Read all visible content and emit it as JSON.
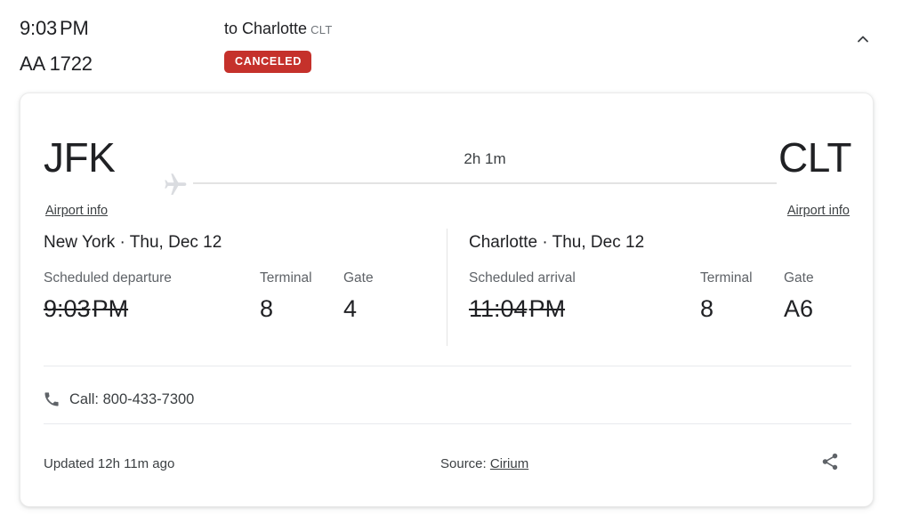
{
  "header": {
    "departure_time": "9:03",
    "departure_ampm": "PM",
    "flight_number": "AA 1722",
    "destination_prefix": "to Charlotte",
    "destination_code": "CLT",
    "status_badge": "CANCELED",
    "collapse_icon": "chevron-up-icon",
    "badge_color": "#c5312b"
  },
  "route": {
    "origin_code": "JFK",
    "destination_code": "CLT",
    "origin_airport_info": "Airport info",
    "destination_airport_info": "Airport info",
    "duration": "2h 1m",
    "plane_icon": "airplane-icon"
  },
  "departure": {
    "title": "New York · Thu, Dec 12",
    "time_label": "Scheduled departure",
    "time_value": "9:03",
    "time_ampm": "PM",
    "time_struck": true,
    "terminal_label": "Terminal",
    "terminal_value": "8",
    "gate_label": "Gate",
    "gate_value": "4"
  },
  "arrival": {
    "title": "Charlotte · Thu, Dec 12",
    "time_label": "Scheduled arrival",
    "time_value": "11:04",
    "time_ampm": "PM",
    "time_struck": true,
    "terminal_label": "Terminal",
    "terminal_value": "8",
    "gate_label": "Gate",
    "gate_value": "A6"
  },
  "contact": {
    "phone_icon": "phone-icon",
    "call_text": "Call: 800-433-7300"
  },
  "footer": {
    "updated": "Updated 12h 11m ago",
    "source_label": "Source:",
    "source_name": "Cirium",
    "share_icon": "share-icon"
  }
}
